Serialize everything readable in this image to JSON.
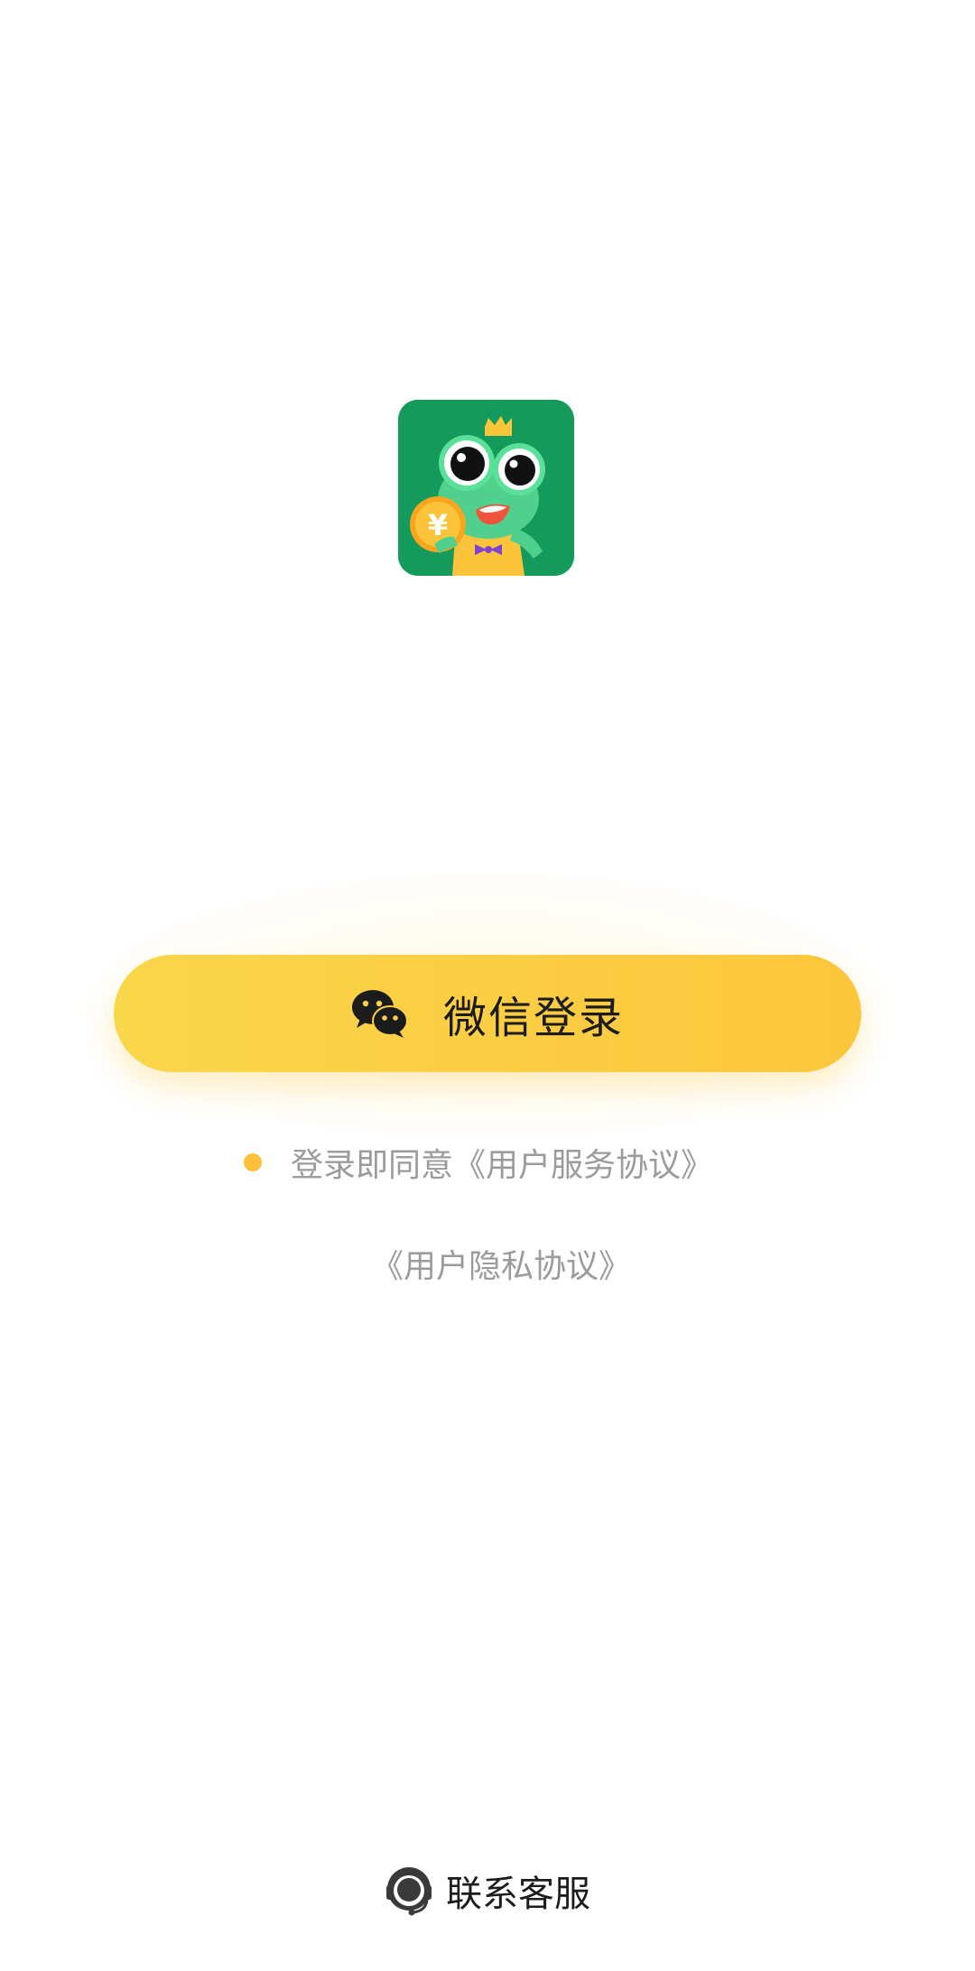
{
  "app_icon": {
    "icon": "frog-mascot-app-icon",
    "coin_symbol": "¥"
  },
  "login": {
    "label": "微信登录",
    "icon": "wechat-icon"
  },
  "agreement": {
    "prefix": "登录即同意",
    "service_link": "《用户服务协议》",
    "privacy_link": "《用户隐私协议》",
    "checked": false
  },
  "support": {
    "label": "联系客服",
    "icon": "headset-icon"
  },
  "colors": {
    "accent_yellow": "#fcc63c",
    "icon_green": "#149a5a",
    "muted_text": "#9b9b9b",
    "dark_text": "#1c1c1c"
  }
}
